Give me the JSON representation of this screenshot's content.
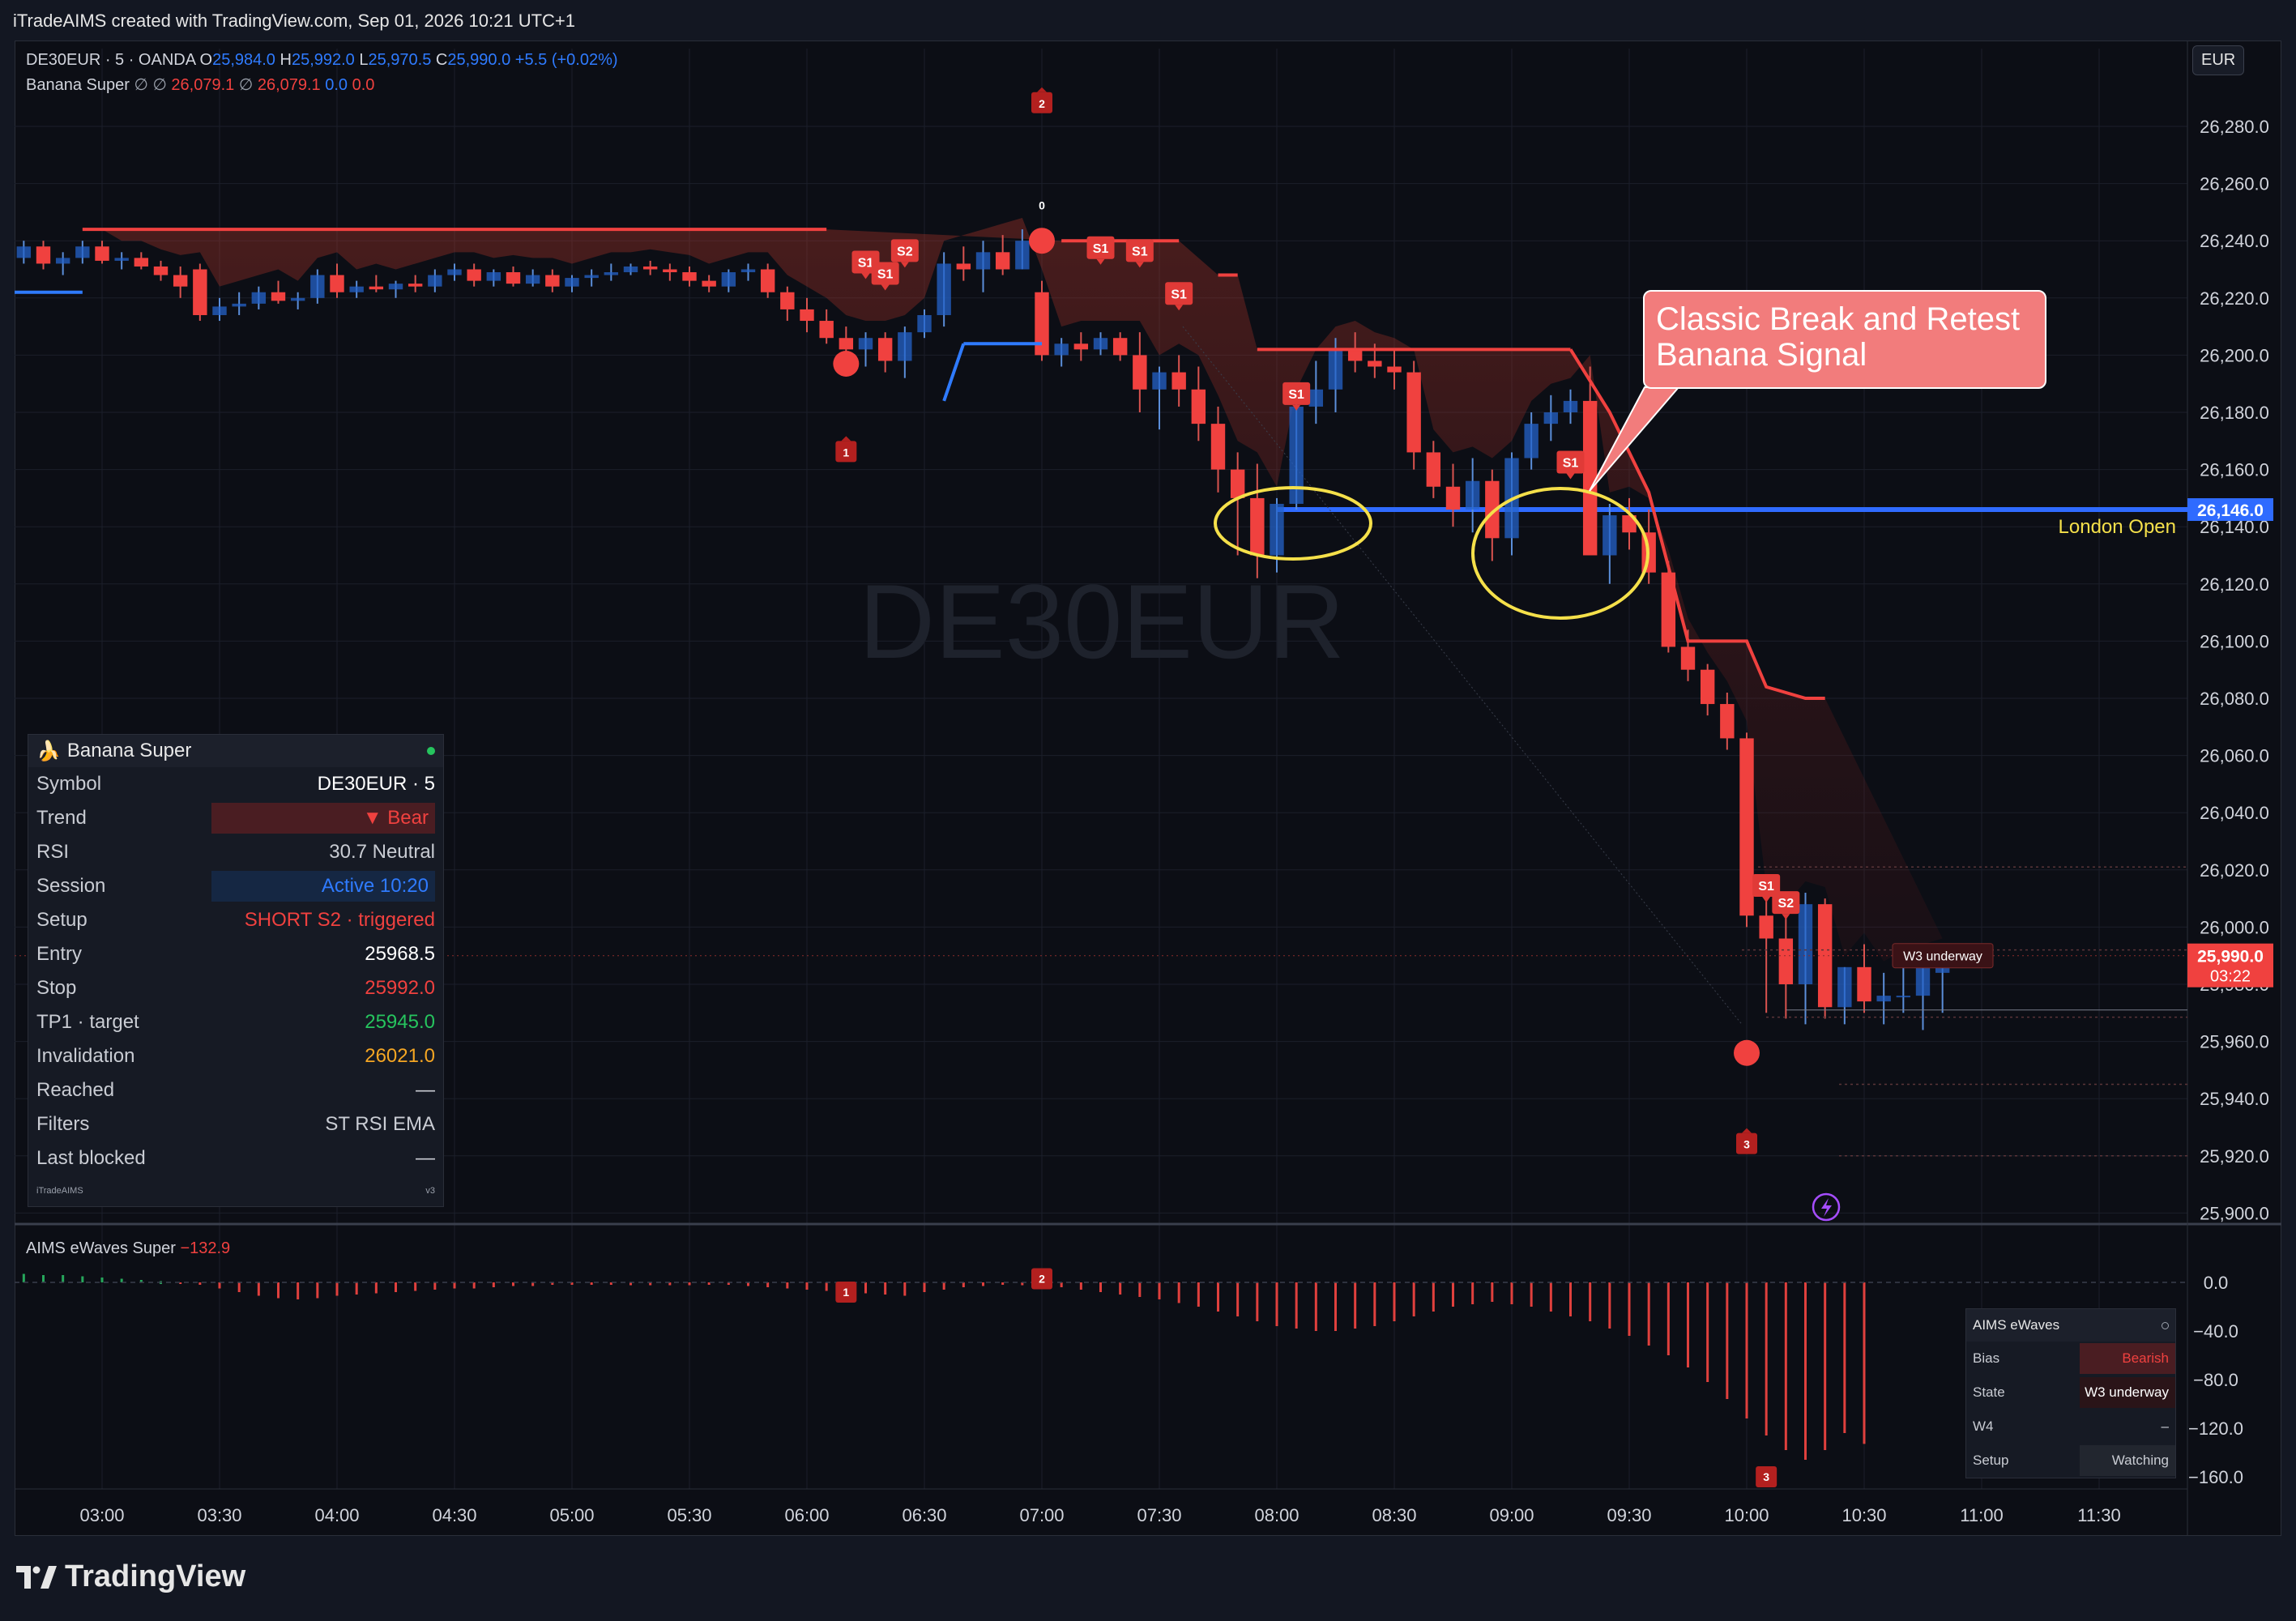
{
  "header": {
    "watermark_text": "iTradeAIMS created with TradingView.com, Sep 01, 2026 10:21 UTC+1"
  },
  "legend": {
    "symbol": "DE30EUR · 5 · OANDA",
    "o_label": "O",
    "o": "25,984.0",
    "h_label": "H",
    "h": "25,992.0",
    "l_label": "L",
    "l": "25,970.5",
    "c_label": "C",
    "c": "25,990.0",
    "change": "+5.5 (+0.02%)",
    "indicator_name": "Banana Super",
    "ind_sym1": "∅",
    "ind_sym2": "∅",
    "ind_v1": "26,079.1",
    "ind_sym3": "∅",
    "ind_v2": "26,079.1",
    "ind_v3": "0.0",
    "ind_v4": "0.0"
  },
  "currency": "EUR",
  "symbol_watermark": "DE30EUR",
  "callout": {
    "line1": "Classic Break and Retest",
    "line2": "Banana Signal"
  },
  "london_open": {
    "label": "London Open",
    "price": "26,146.0"
  },
  "current_price": {
    "price": "25,990.0",
    "countdown": "03:22"
  },
  "w3_label": "W3 underway",
  "panel": {
    "icon": "🍌",
    "title": "Banana Super",
    "rows": [
      {
        "k": "Symbol",
        "v": "DE30EUR · 5"
      },
      {
        "k": "Trend",
        "v": "▼ Bear"
      },
      {
        "k": "RSI",
        "v": "30.7  Neutral"
      },
      {
        "k": "Session",
        "v": "Active  10:20"
      },
      {
        "k": "Setup",
        "v": "SHORT  S2  ·  triggered"
      },
      {
        "k": "Entry",
        "v": "25968.5"
      },
      {
        "k": "Stop",
        "v": "25992.0"
      },
      {
        "k": "TP1 · target",
        "v": "25945.0"
      },
      {
        "k": "Invalidation",
        "v": "26021.0"
      },
      {
        "k": "Reached",
        "v": "—"
      },
      {
        "k": "Filters",
        "v": "ST RSI EMA"
      },
      {
        "k": "Last blocked",
        "v": "—"
      }
    ],
    "footer_left": "iTradeAIMS",
    "footer_right": "v3"
  },
  "ewaves": {
    "name": "AIMS eWaves Super",
    "value": "−132.9",
    "panel_title": "AIMS eWaves",
    "rows": [
      {
        "k": "Bias",
        "v": "Bearish"
      },
      {
        "k": "State",
        "v": "W3 underway"
      },
      {
        "k": "W4",
        "v": "–"
      },
      {
        "k": "Setup",
        "v": "Watching"
      }
    ]
  },
  "logo_text": "TradingView",
  "colors": {
    "bull": "#2f7bff",
    "bear": "#f0413f",
    "background": "#0c0e15",
    "supertrend": "#f0413f",
    "london_line": "#2f6bff",
    "ellipse": "#f5e04a"
  },
  "chart_data": [
    {
      "type": "candlestick",
      "title": "DE30EUR · 5 · OANDA",
      "x_axis_labels": [
        "03:00",
        "03:30",
        "04:00",
        "04:30",
        "05:00",
        "05:30",
        "06:00",
        "06:30",
        "07:00",
        "07:30",
        "08:00",
        "08:30",
        "09:00",
        "09:30",
        "10:00",
        "10:30",
        "11:00",
        "11:30"
      ],
      "y_ticks": [
        26280,
        26260,
        26240,
        26220,
        26200,
        26180,
        26160,
        26140,
        26120,
        26100,
        26080,
        26060,
        26040,
        26020,
        26000,
        25980,
        25960,
        25940,
        25920,
        25900
      ],
      "ylim": [
        25898,
        26302
      ],
      "bar_interval_min": 5,
      "first_bar_time": "02:20",
      "candles_ohlc": [
        [
          26234,
          26240,
          26230,
          26236
        ],
        [
          26236,
          26242,
          26234,
          26240
        ],
        [
          26240,
          26242,
          26226,
          26228
        ],
        [
          26228,
          26237,
          26226,
          26234
        ],
        [
          26234,
          26240,
          26232,
          26238
        ],
        [
          26238,
          26240,
          26230,
          26232
        ],
        [
          26232,
          26236,
          26228,
          26234
        ],
        [
          26234,
          26240,
          26232,
          26238
        ],
        [
          26238,
          26240,
          26232,
          26233
        ],
        [
          26233,
          26236,
          26230,
          26234
        ],
        [
          26234,
          26236,
          26230,
          26231
        ],
        [
          26231,
          26233,
          26226,
          26228
        ],
        [
          26228,
          26231,
          26220,
          26224
        ],
        [
          26230,
          26232,
          26212,
          26214
        ],
        [
          26214,
          26220,
          26212,
          26217
        ],
        [
          26217,
          26222,
          26214,
          26218
        ],
        [
          26218,
          26224,
          26216,
          26222
        ],
        [
          26222,
          26226,
          26218,
          26219
        ],
        [
          26219,
          26222,
          26216,
          26220
        ],
        [
          26220,
          26230,
          26218,
          26228
        ],
        [
          26228,
          26232,
          26220,
          26222
        ],
        [
          26222,
          26226,
          26220,
          26224
        ],
        [
          26224,
          26228,
          26222,
          26223
        ],
        [
          26223,
          26226,
          26220,
          26225
        ],
        [
          26225,
          26228,
          26222,
          26224
        ],
        [
          26224,
          26230,
          26222,
          26228
        ],
        [
          26228,
          26232,
          26226,
          26230
        ],
        [
          26230,
          26232,
          26224,
          26226
        ],
        [
          26226,
          26230,
          26224,
          26229
        ],
        [
          26229,
          26231,
          26224,
          26225
        ],
        [
          26225,
          26230,
          26224,
          26228
        ],
        [
          26228,
          26230,
          26222,
          26224
        ],
        [
          26224,
          26228,
          26222,
          26227
        ],
        [
          26227,
          26230,
          26224,
          26228
        ],
        [
          26228,
          26232,
          26226,
          26229
        ],
        [
          26229,
          26232,
          26228,
          26231
        ],
        [
          26231,
          26233,
          26228,
          26230
        ],
        [
          26230,
          26232,
          26226,
          26229
        ],
        [
          26229,
          26231,
          26224,
          26226
        ],
        [
          26226,
          26228,
          26222,
          26224
        ],
        [
          26224,
          26230,
          26222,
          26229
        ],
        [
          26229,
          26232,
          26226,
          26230
        ],
        [
          26230,
          26232,
          26220,
          26222
        ],
        [
          26222,
          26224,
          26212,
          26216
        ],
        [
          26216,
          26220,
          26208,
          26212
        ],
        [
          26212,
          26216,
          26204,
          26206
        ],
        [
          26206,
          26210,
          26198,
          26202
        ],
        [
          26202,
          26208,
          26196,
          26206
        ],
        [
          26206,
          26208,
          26194,
          26198
        ],
        [
          26198,
          26210,
          26192,
          26208
        ],
        [
          26208,
          26216,
          26206,
          26214
        ],
        [
          26214,
          26236,
          26210,
          26232
        ],
        [
          26232,
          26238,
          26226,
          26230
        ],
        [
          26230,
          26240,
          26222,
          26236
        ],
        [
          26236,
          26242,
          26228,
          26230
        ],
        [
          26230,
          26244,
          26230,
          26240
        ],
        [
          26222,
          26226,
          26198,
          26200
        ],
        [
          26200,
          26206,
          26196,
          26204
        ],
        [
          26204,
          26208,
          26198,
          26202
        ],
        [
          26202,
          26208,
          26200,
          26206
        ],
        [
          26206,
          26208,
          26198,
          26200
        ],
        [
          26200,
          26208,
          26180,
          26188
        ],
        [
          26188,
          26196,
          26174,
          26194
        ],
        [
          26194,
          26200,
          26182,
          26188
        ],
        [
          26188,
          26196,
          26170,
          26176
        ],
        [
          26176,
          26182,
          26152,
          26160
        ],
        [
          26160,
          26166,
          26130,
          26150
        ],
        [
          26150,
          26162,
          26122,
          26130
        ],
        [
          26130,
          26150,
          26124,
          26148
        ],
        [
          26148,
          26184,
          26146,
          26182
        ],
        [
          26182,
          26198,
          26176,
          26188
        ],
        [
          26188,
          26206,
          26180,
          26202
        ],
        [
          26202,
          26208,
          26194,
          26198
        ],
        [
          26198,
          26204,
          26192,
          26196
        ],
        [
          26196,
          26202,
          26188,
          26194
        ],
        [
          26194,
          26198,
          26160,
          26166
        ],
        [
          26166,
          26170,
          26150,
          26154
        ],
        [
          26154,
          26162,
          26140,
          26146
        ],
        [
          26146,
          26164,
          26138,
          26156
        ],
        [
          26156,
          26160,
          26128,
          26136
        ],
        [
          26136,
          26166,
          26130,
          26164
        ],
        [
          26164,
          26180,
          26160,
          26176
        ],
        [
          26176,
          26186,
          26170,
          26180
        ],
        [
          26180,
          26188,
          26176,
          26184
        ],
        [
          26184,
          26196,
          26130,
          26130
        ],
        [
          26130,
          26148,
          26120,
          26144
        ],
        [
          26144,
          26150,
          26132,
          26138
        ],
        [
          26138,
          26146,
          26120,
          26124
        ],
        [
          26124,
          26128,
          26096,
          26098
        ],
        [
          26098,
          26104,
          26086,
          26090
        ],
        [
          26090,
          26092,
          26074,
          26078
        ],
        [
          26078,
          26082,
          26062,
          26066
        ],
        [
          26066,
          26068,
          26000,
          26004
        ],
        [
          26004,
          26010,
          25970,
          25996
        ],
        [
          25996,
          26004,
          25968,
          25980
        ],
        [
          25980,
          26012,
          25966,
          26008
        ],
        [
          26008,
          26010,
          25968,
          25972
        ],
        [
          25972,
          25986,
          25966,
          25986
        ],
        [
          25986,
          25994,
          25970,
          25974
        ],
        [
          25974,
          25984,
          25966,
          25976
        ],
        [
          25976,
          25988,
          25970,
          25976
        ],
        [
          25976,
          25990,
          25964,
          25990
        ],
        [
          25984,
          25992,
          25970,
          25990
        ]
      ],
      "london_open_level": 26146.0,
      "supertrend_bear_segments": [
        {
          "from": "02:55",
          "to": "06:05",
          "value": 26244
        },
        {
          "from": "07:05",
          "to": "07:35",
          "value": 26240
        },
        {
          "from": "07:45",
          "to": "07:50",
          "value": 26228
        },
        {
          "from": "07:55",
          "to": "09:15",
          "value": 26202
        }
      ],
      "supertrend_decline": [
        [
          "09:15",
          26202
        ],
        [
          "09:25",
          26180
        ],
        [
          "09:35",
          26152
        ],
        [
          "09:45",
          26100
        ],
        [
          "10:00",
          26100
        ],
        [
          "10:05",
          26084
        ],
        [
          "10:15",
          26080
        ],
        [
          "10:20",
          26080
        ]
      ],
      "supertrend_bull_segments": [
        {
          "from": "02:20",
          "to": "02:55",
          "value": 26222
        },
        {
          "from": "06:40",
          "to": "07:00",
          "value": 26204
        }
      ],
      "signals": [
        {
          "label": "S1",
          "time": "06:15",
          "price": 26232
        },
        {
          "label": "S1",
          "time": "06:20",
          "price": 26228
        },
        {
          "label": "S2",
          "time": "06:25",
          "price": 26236
        },
        {
          "label": "S1",
          "time": "07:15",
          "price": 26237
        },
        {
          "label": "S1",
          "time": "07:25",
          "price": 26236
        },
        {
          "label": "S1",
          "time": "07:35",
          "price": 26221
        },
        {
          "label": "S1",
          "time": "08:05",
          "price": 26186
        },
        {
          "label": "S1",
          "time": "09:15",
          "price": 26162
        },
        {
          "label": "S1",
          "time": "10:05",
          "price": 26014
        },
        {
          "label": "S2",
          "time": "10:10",
          "price": 26008
        }
      ],
      "wave_markers": [
        {
          "label": "1",
          "time": "06:10",
          "price": 26166
        },
        {
          "label": "2",
          "time": "07:00",
          "price": 26288
        },
        {
          "label": "3",
          "time": "10:00",
          "price": 25924
        }
      ],
      "pivot_dots": [
        {
          "time": "06:10",
          "price": 26197
        },
        {
          "time": "07:00",
          "price": 26240
        },
        {
          "time": "10:00",
          "price": 25956
        }
      ],
      "zero_label": {
        "text": "0",
        "time": "07:00",
        "price": 26251
      }
    },
    {
      "type": "bar",
      "title": "AIMS eWaves Super",
      "ylim": [
        -175,
        10
      ],
      "y_ticks": [
        0.0,
        -40.0,
        -80.0,
        -120.0,
        -160.0
      ],
      "series": [
        {
          "name": "AIMS eWaves Super",
          "values": [
            8,
            8,
            8,
            8,
            7,
            6,
            6,
            5,
            4,
            3,
            2,
            1,
            0,
            -2,
            -5,
            -8,
            -11,
            -13,
            -14,
            -13,
            -11,
            -10,
            -9,
            -8,
            -7,
            -6,
            -5,
            -5,
            -4,
            -3,
            -3,
            -2,
            -2,
            -2,
            -2,
            -1,
            -1,
            -1,
            -1,
            -2,
            -2,
            -3,
            -4,
            -5,
            -6,
            -7,
            -8,
            -9,
            -10,
            -11,
            -8,
            -6,
            -4,
            -3,
            -2,
            -1,
            -2,
            -4,
            -6,
            -8,
            -10,
            -12,
            -14,
            -17,
            -20,
            -24,
            -28,
            -32,
            -36,
            -38,
            -40,
            -40,
            -38,
            -36,
            -32,
            -28,
            -24,
            -20,
            -18,
            -16,
            -18,
            -20,
            -24,
            -28,
            -32,
            -38,
            -44,
            -52,
            -60,
            -70,
            -82,
            -96,
            -112,
            -126,
            -138,
            -146,
            -138,
            -124,
            -132.9
          ],
          "bull_until_index": 12
        }
      ],
      "wave_markers": [
        {
          "label": "1",
          "time": "06:10"
        },
        {
          "label": "2",
          "time": "07:00"
        },
        {
          "label": "3",
          "time": "10:05"
        }
      ]
    }
  ]
}
